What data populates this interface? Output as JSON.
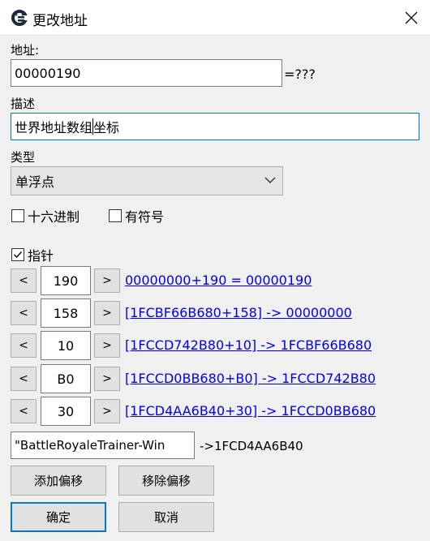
{
  "window": {
    "title": "更改地址",
    "icon": "cheat-engine-icon",
    "close_icon": "close-icon"
  },
  "address": {
    "label": "地址:",
    "value": "00000190",
    "result": "=???"
  },
  "description": {
    "label": "描述",
    "value_before_caret": "世界地址数组",
    "value_after_caret": "坐标"
  },
  "type": {
    "label": "类型",
    "selected": "单浮点"
  },
  "options": {
    "hex": {
      "label": "十六进制",
      "checked": false
    },
    "signed": {
      "label": "有符号",
      "checked": false
    }
  },
  "pointer": {
    "label": "指针",
    "checked": true,
    "decrement_label": "<",
    "increment_label": ">",
    "offsets": [
      {
        "value": "190",
        "expression": "00000000+190 = 00000190"
      },
      {
        "value": "158",
        "expression": "[1FCBF66B680+158] -> 00000000"
      },
      {
        "value": "10",
        "expression": "[1FCCD742B80+10] -> 1FCBF66B680"
      },
      {
        "value": "B0",
        "expression": "[1FCCD0BB680+B0] -> 1FCCD742B80"
      },
      {
        "value": "30",
        "expression": "[1FCD4AA6B40+30] -> 1FCCD0BB680"
      }
    ],
    "base": {
      "value": "\"BattleRoyaleTrainer-Win",
      "result": "->1FCD4AA6B40"
    }
  },
  "buttons": {
    "add_offset": "添加偏移",
    "remove_offset": "移除偏移",
    "ok": "确定",
    "cancel": "取消"
  }
}
